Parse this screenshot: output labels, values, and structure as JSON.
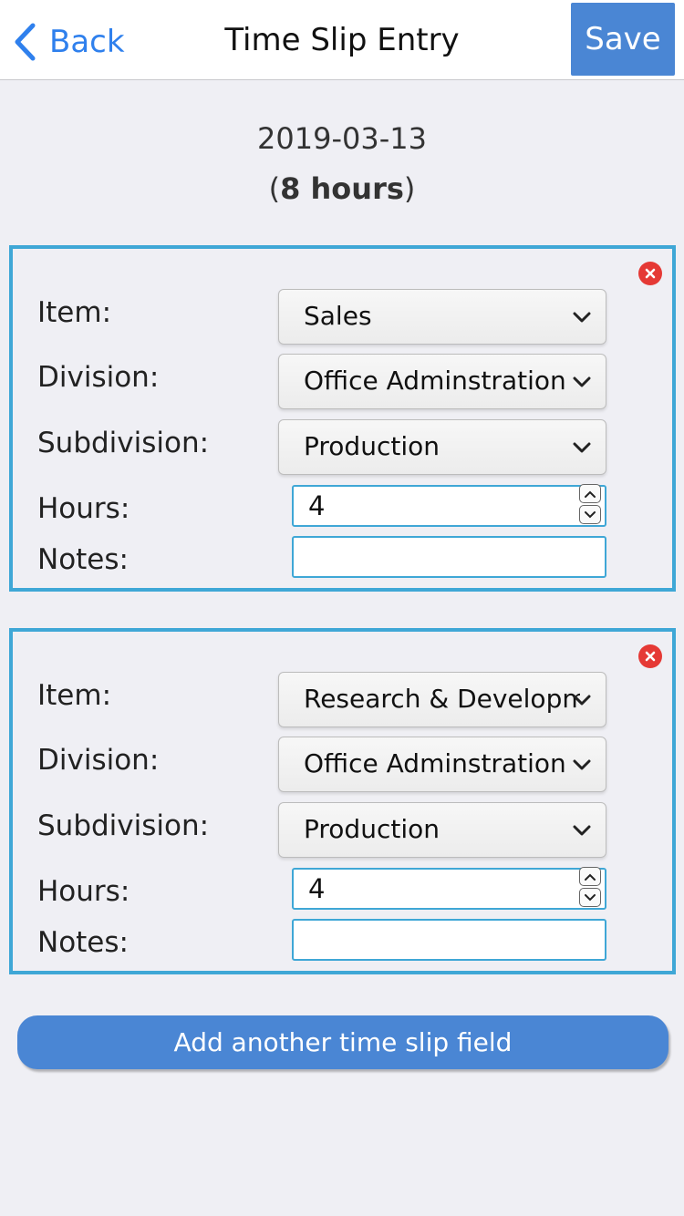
{
  "nav": {
    "back_label": "Back",
    "title": "Time Slip Entry",
    "save_label": "Save"
  },
  "summary": {
    "date": "2019-03-13",
    "hours_prefix": "(",
    "hours_bold": "8 hours",
    "hours_suffix": ")"
  },
  "labels": {
    "item": "Item:",
    "division": "Division:",
    "subdivision": "Subdivision:",
    "hours": "Hours:",
    "notes": "Notes:"
  },
  "entries": [
    {
      "item": "Sales",
      "division": "Office Adminstration",
      "subdivision": "Production",
      "hours": "4",
      "notes": ""
    },
    {
      "item": "Research & Development",
      "division": "Office Adminstration",
      "subdivision": "Production",
      "hours": "4",
      "notes": ""
    }
  ],
  "add_button_label": "Add another time slip field",
  "colors": {
    "accent": "#4a86d4",
    "link": "#2f80ed",
    "card_border": "#3fa7d6",
    "remove": "#e53935",
    "background": "#efeff4"
  },
  "icons": {
    "back": "chevron-left-icon",
    "remove": "close-circle-icon",
    "dropdown": "chevron-down-icon",
    "spin_up": "chevron-up-icon",
    "spin_down": "chevron-down-icon"
  }
}
